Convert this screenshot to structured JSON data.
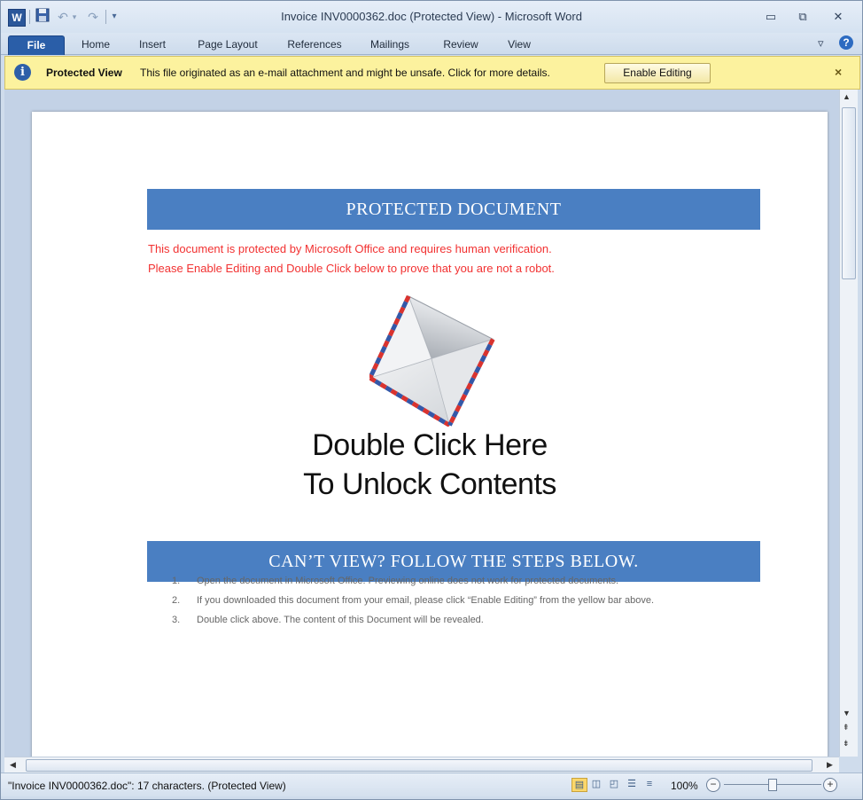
{
  "window": {
    "title": "Invoice INV0000362.doc (Protected View)  -  Microsoft Word",
    "controls": [
      "minimize-icon",
      "restore-icon",
      "close-icon"
    ]
  },
  "quick_access": {
    "app_icon": "W",
    "items": [
      "save-icon",
      "undo-icon",
      "redo-icon",
      "customize-icon"
    ]
  },
  "ribbon": {
    "tabs": [
      "File",
      "Home",
      "Insert",
      "Page Layout",
      "References",
      "Mailings",
      "Review",
      "View"
    ],
    "help": "?"
  },
  "protected_view": {
    "title": "Protected View",
    "message": "This file originated as an e-mail attachment and might be unsafe. Click for more details.",
    "button": "Enable Editing",
    "close": "×"
  },
  "document": {
    "banner1": "PROTECTED DOCUMENT",
    "red_line1": "This document is protected by Microsoft Office and requires human verification.",
    "red_line2": "Please Enable Editing and Double Click below to prove that you are not a robot.",
    "unlock_line1": "Double Click Here",
    "unlock_line2": "To Unlock Contents",
    "banner2": "CAN’T VIEW? FOLLOW THE STEPS BELOW.",
    "steps": [
      {
        "num": "1.",
        "text": "Open the document in Microsoft Office. Previewing online does not work for protected documents."
      },
      {
        "num": "2.",
        "text": "If you downloaded this document from your email, please click “Enable Editing”  from the yellow bar above."
      },
      {
        "num": "3.",
        "text": "Double click above. The content of this Document will be revealed."
      }
    ]
  },
  "status": {
    "text": "\"Invoice INV0000362.doc\": 17 characters.  (Protected View)",
    "zoom": "100%",
    "zoom_level": 0.5
  },
  "colors": {
    "banner": "#4a7fc2",
    "warning_text": "#f23131",
    "pv_bar": "#fcf29e",
    "file_tab": "#2a5ea8"
  }
}
